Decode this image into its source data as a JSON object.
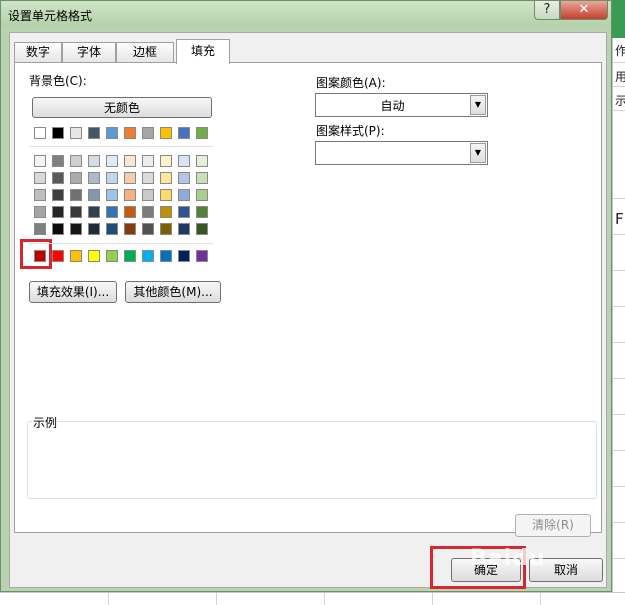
{
  "window": {
    "title": "设置单元格格式",
    "help_glyph": "?",
    "close_glyph": "✕"
  },
  "tabs": [
    {
      "label": "数字"
    },
    {
      "label": "字体"
    },
    {
      "label": "边框"
    },
    {
      "label": "填充",
      "active": true
    }
  ],
  "fill": {
    "background_color_label": "背景色(C):",
    "no_color_button": "无颜色",
    "fill_effects_button": "填充效果(I)...",
    "more_colors_button": "其他颜色(M)...",
    "pattern_color_label": "图案颜色(A):",
    "pattern_color_value": "自动",
    "pattern_style_label": "图案样式(P):",
    "pattern_style_value": "",
    "sample_label": "示例",
    "clear_button": "清除(R)",
    "selected_color": "#c00000"
  },
  "palette": {
    "theme_row": [
      "#ffffff",
      "#000000",
      "#e7e6e6",
      "#44546a",
      "#5b9bd5",
      "#ed7d31",
      "#a5a5a5",
      "#ffc000",
      "#4472c4",
      "#70ad47"
    ],
    "shade_rows": [
      [
        "#f2f2f2",
        "#7f7f7f",
        "#d0cece",
        "#d6dce4",
        "#deebf6",
        "#fbe5d5",
        "#ededed",
        "#fff2cc",
        "#d9e2f3",
        "#e2efd9"
      ],
      [
        "#d8d8d8",
        "#595959",
        "#aeaaaa",
        "#adb9ca",
        "#bdd7ee",
        "#f7cbac",
        "#dbdbdb",
        "#fee599",
        "#b4c6e7",
        "#c5e0b3"
      ],
      [
        "#bfbfbf",
        "#3f3f3f",
        "#757070",
        "#8496b0",
        "#9cc3e5",
        "#f4b183",
        "#c9c9c9",
        "#ffd965",
        "#8eaadb",
        "#a8d08d"
      ],
      [
        "#a5a5a5",
        "#262626",
        "#3a3838",
        "#323f4f",
        "#2e75b5",
        "#c55a11",
        "#7b7b7b",
        "#bf9000",
        "#2f5496",
        "#538135"
      ],
      [
        "#7f7f7f",
        "#0c0c0c",
        "#171616",
        "#222a35",
        "#1e4e79",
        "#833c0b",
        "#525252",
        "#7f6000",
        "#1f3864",
        "#375623"
      ]
    ],
    "standard_row": [
      "#c00000",
      "#ff0000",
      "#ffc000",
      "#ffff00",
      "#92d050",
      "#00b050",
      "#00b0f0",
      "#0070c0",
      "#002060",
      "#7030a0"
    ]
  },
  "footer": {
    "ok_button": "确定",
    "cancel_button": "取消"
  },
  "background": {
    "sheet_text": [
      "作",
      "用",
      "示",
      "F"
    ]
  },
  "watermark": "Baidu"
}
